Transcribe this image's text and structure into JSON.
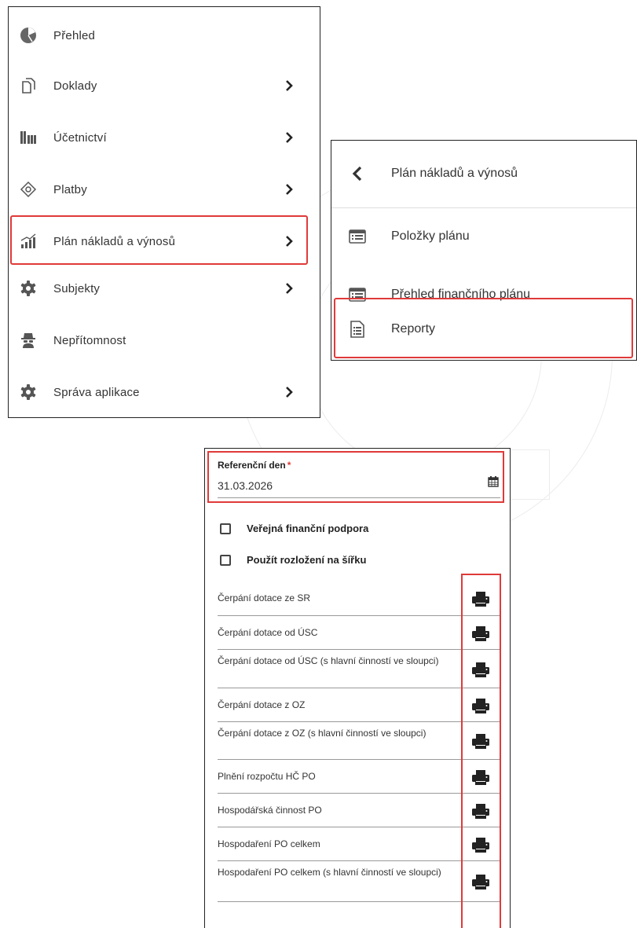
{
  "main_menu": {
    "items": [
      {
        "label": "Přehled",
        "icon": "pie-chart-icon",
        "has_submenu": false
      },
      {
        "label": "Doklady",
        "icon": "documents-icon",
        "has_submenu": true
      },
      {
        "label": "Účetnictví",
        "icon": "ledger-icon",
        "has_submenu": true
      },
      {
        "label": "Platby",
        "icon": "payment-icon",
        "has_submenu": true
      },
      {
        "label": "Plán nákladů a výnosů",
        "icon": "growth-chart-icon",
        "has_submenu": true,
        "highlighted": true
      },
      {
        "label": "Subjekty",
        "icon": "gear-icon",
        "has_submenu": true
      },
      {
        "label": "Nepřítomnost",
        "icon": "spy-icon",
        "has_submenu": false
      },
      {
        "label": "Správa aplikace",
        "icon": "gear-icon",
        "has_submenu": true
      }
    ]
  },
  "submenu": {
    "title": "Plán nákladů a výnosů",
    "back_icon": "chevron-left-icon",
    "items": [
      {
        "label": "Položky plánu",
        "icon": "list-icon"
      },
      {
        "label": "Přehled finančního plánu",
        "icon": "list-icon"
      },
      {
        "label": "Reporty",
        "icon": "report-document-icon",
        "highlighted": true
      }
    ]
  },
  "report_form": {
    "reference_day": {
      "label": "Referenční den",
      "required_mark": "*",
      "value": "31.03.2026",
      "icon": "calendar-icon"
    },
    "checkboxes": [
      {
        "label": "Veřejná finanční podpora",
        "checked": false
      },
      {
        "label": "Použít rozložení na šířku",
        "checked": false
      }
    ],
    "reports": [
      "Čerpání dotace ze SR",
      "Čerpání dotace od ÚSC",
      "Čerpání dotace od ÚSC (s hlavní činností ve sloupci)",
      "Čerpání dotace z OZ",
      "Čerpání dotace z OZ (s hlavní činností ve sloupci)",
      "Plnění rozpočtu HČ PO",
      "Hospodářská činnost PO",
      "Hospodaření PO celkem",
      "Hospodaření PO celkem (s hlavní činností ve sloupci)"
    ],
    "print_icon": "printer-icon"
  },
  "colors": {
    "highlight": "#e03a3a",
    "text": "#333333",
    "icon": "#666666",
    "divider": "#999999"
  }
}
